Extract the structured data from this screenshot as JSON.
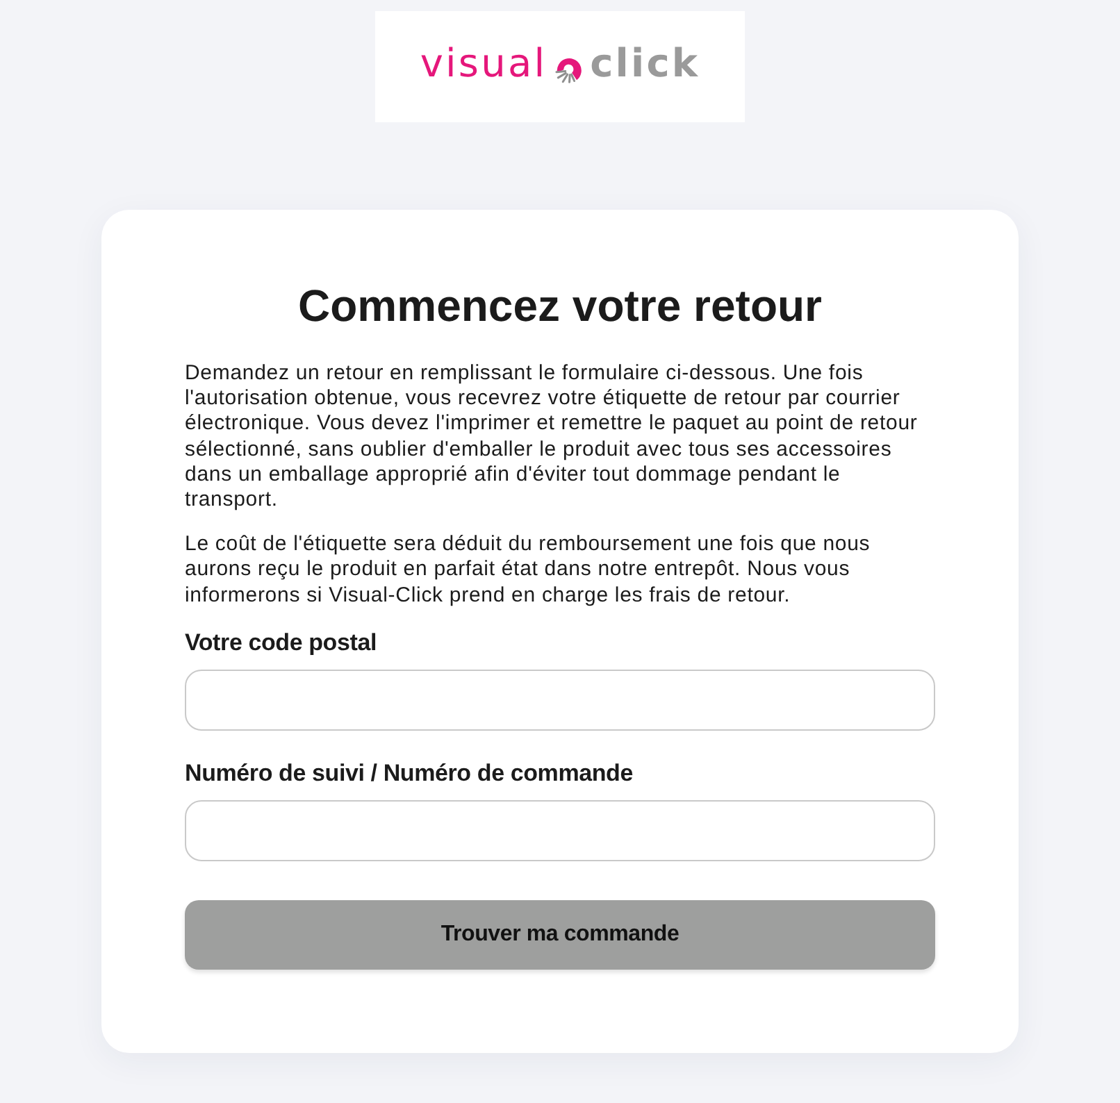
{
  "logo": {
    "word_1": "visual",
    "word_2": "click"
  },
  "card": {
    "title": "Commencez votre retour",
    "paragraphs": [
      "Demandez un retour en remplissant le formulaire ci-dessous. Une fois l'autorisation obtenue, vous recevrez votre étiquette de retour par courrier électronique. Vous devez l'imprimer et remettre le paquet au point de retour sélectionné, sans oublier d'emballer le produit avec tous ses accessoires dans un emballage approprié afin d'éviter tout dommage pendant le transport.",
      "Le coût de l'étiquette sera déduit du remboursement une fois que nous aurons reçu le produit en parfait état dans notre entrepôt. Nous vous informerons si Visual-Click prend en charge les frais de retour."
    ],
    "fields": [
      {
        "label": "Votre code postal"
      },
      {
        "label": "Numéro de suivi / Numéro de commande"
      }
    ],
    "button": "Trouver ma commande"
  }
}
